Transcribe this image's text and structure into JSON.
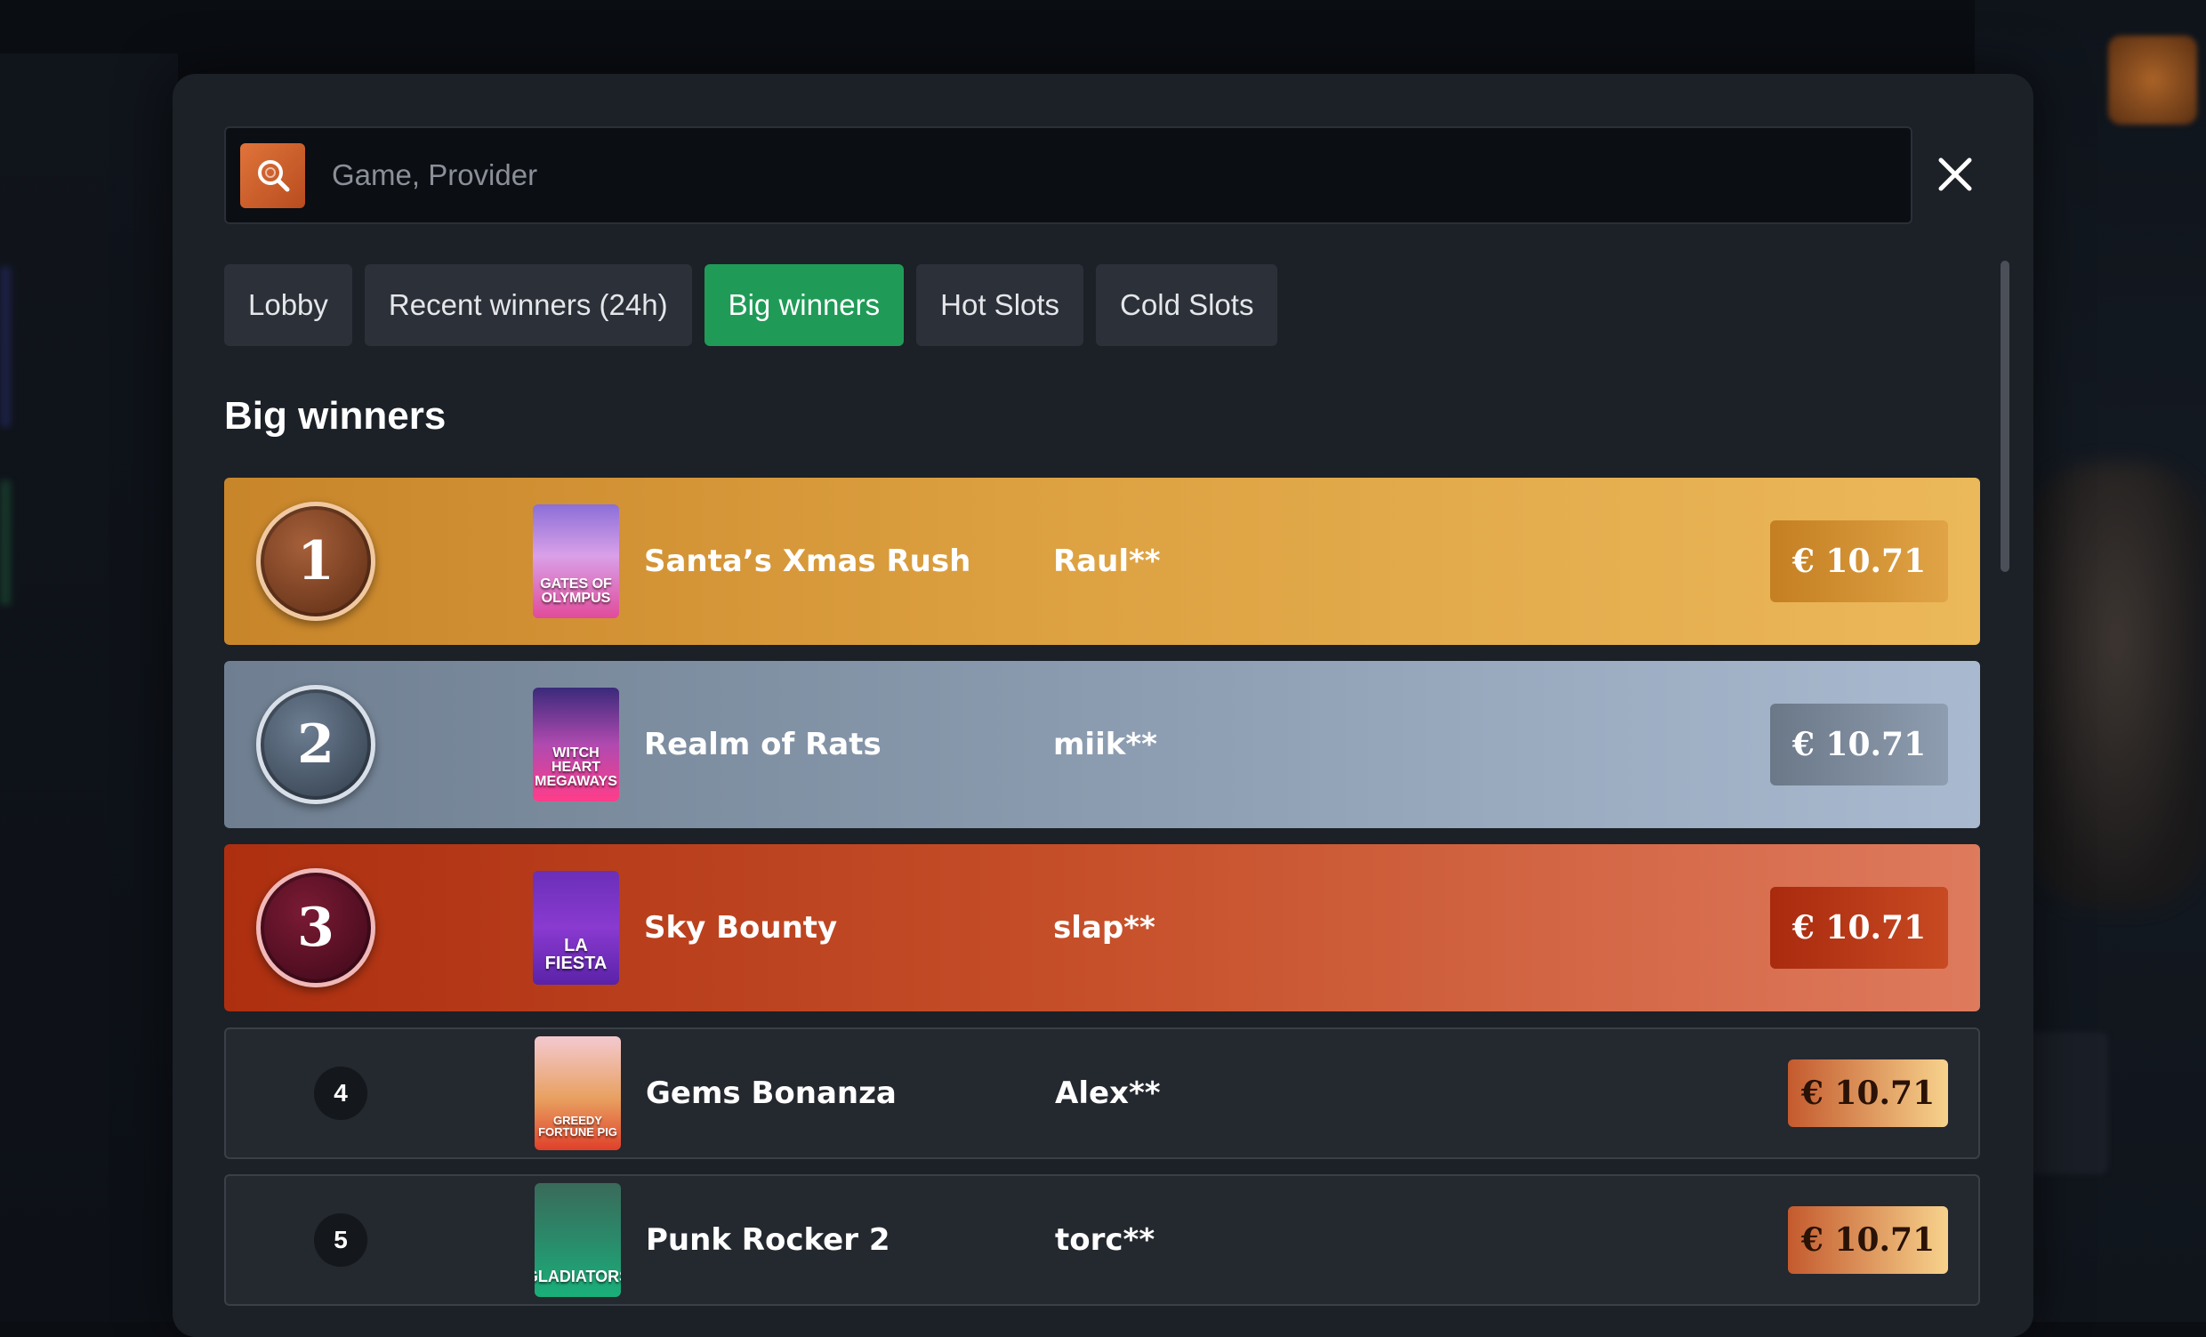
{
  "search": {
    "placeholder": "Game, Provider"
  },
  "tabs": [
    {
      "label": "Lobby",
      "active": false
    },
    {
      "label": "Recent winners (24h)",
      "active": false
    },
    {
      "label": "Big winners",
      "active": true
    },
    {
      "label": "Hot Slots",
      "active": false
    },
    {
      "label": "Cold Slots",
      "active": false
    }
  ],
  "section_title": "Big winners",
  "winners": [
    {
      "rank": "1",
      "game": "Santa’s Xmas Rush",
      "player": "Raul**",
      "amount": "€ 10.71",
      "thumb_label": "GATES OF OLYMPUS"
    },
    {
      "rank": "2",
      "game": "Realm of Rats",
      "player": "miik**",
      "amount": "€ 10.71",
      "thumb_label": "WITCH HEART MEGAWAYS"
    },
    {
      "rank": "3",
      "game": "Sky Bounty",
      "player": "slap**",
      "amount": "€ 10.71",
      "thumb_label": "LA FIESTA"
    },
    {
      "rank": "4",
      "game": "Gems Bonanza",
      "player": "Alex**",
      "amount": "€ 10.71",
      "thumb_label": "GREEDY FORTUNE PIG"
    },
    {
      "rank": "5",
      "game": "Punk Rocker 2",
      "player": "torc**",
      "amount": "€ 10.71",
      "thumb_label": "GLADIATORS"
    }
  ],
  "colors": {
    "accent_green": "#1f9b57",
    "search_orange": "#e0743a",
    "modal_bg": "#1c2027"
  },
  "icons": {
    "search": "search-icon",
    "close": "close-icon"
  }
}
